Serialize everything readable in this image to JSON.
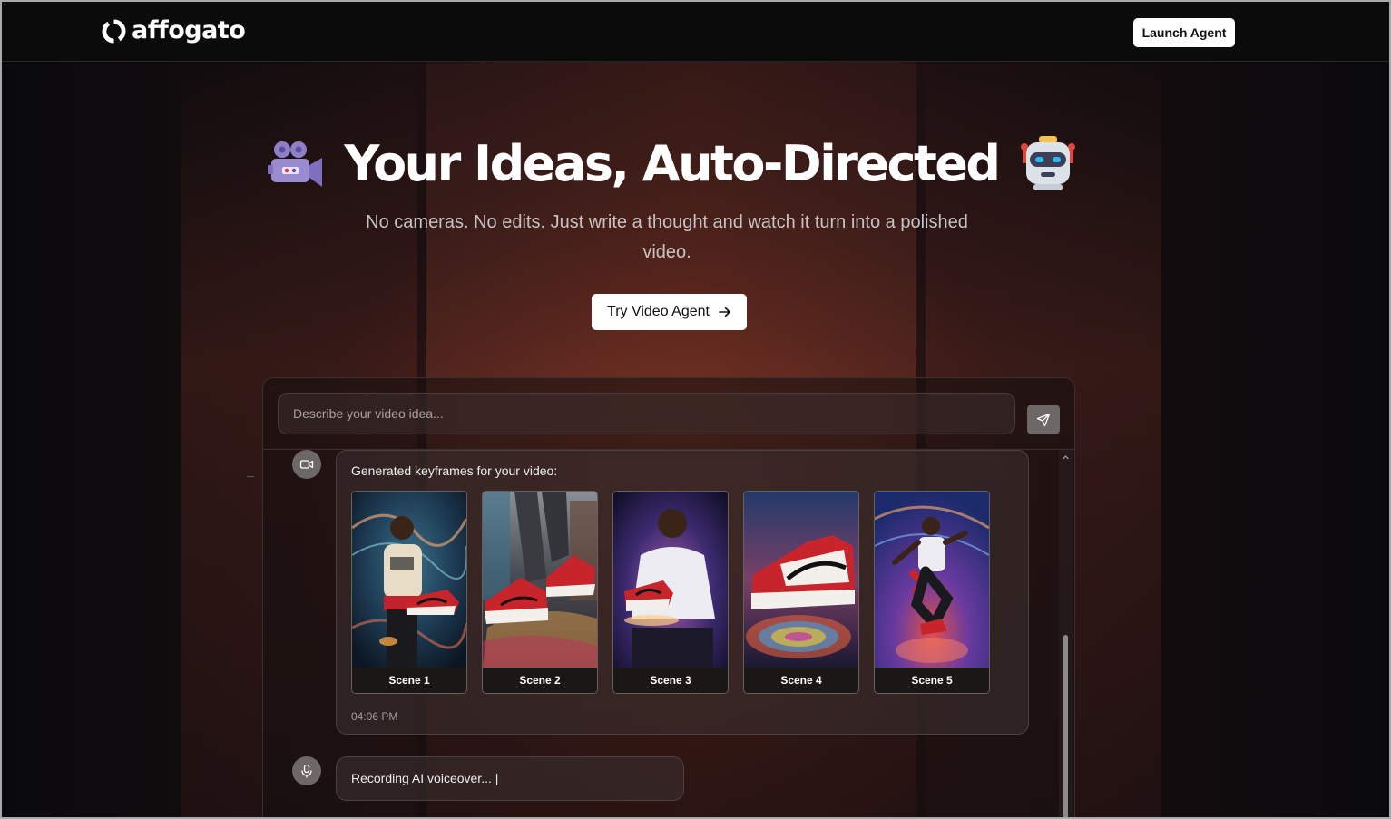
{
  "header": {
    "brand": "affogato",
    "launch_label": "Launch Agent"
  },
  "hero": {
    "title": "Your Ideas, Auto-Directed",
    "subtitle": "No cameras. No edits. Just write a thought and watch it turn into a polished video.",
    "cta_label": "Try Video Agent",
    "left_emoji": "video-camera-icon",
    "right_emoji": "robot-icon"
  },
  "composer": {
    "placeholder": "Describe your video idea...",
    "send_icon": "send-icon"
  },
  "messages": {
    "keyframes": {
      "icon": "video-icon",
      "text": "Generated keyframes for your video:",
      "scenes": [
        {
          "label": "Scene 1"
        },
        {
          "label": "Scene 2"
        },
        {
          "label": "Scene 3"
        },
        {
          "label": "Scene 4"
        },
        {
          "label": "Scene 5"
        }
      ],
      "timestamp": "04:06 PM"
    },
    "voiceover": {
      "icon": "microphone-icon",
      "text": "Recording AI voiceover... |"
    }
  },
  "colors": {
    "accent_red": "#c8242c",
    "button_bg": "#ffffff",
    "header_bg": "#0b0b0b"
  }
}
